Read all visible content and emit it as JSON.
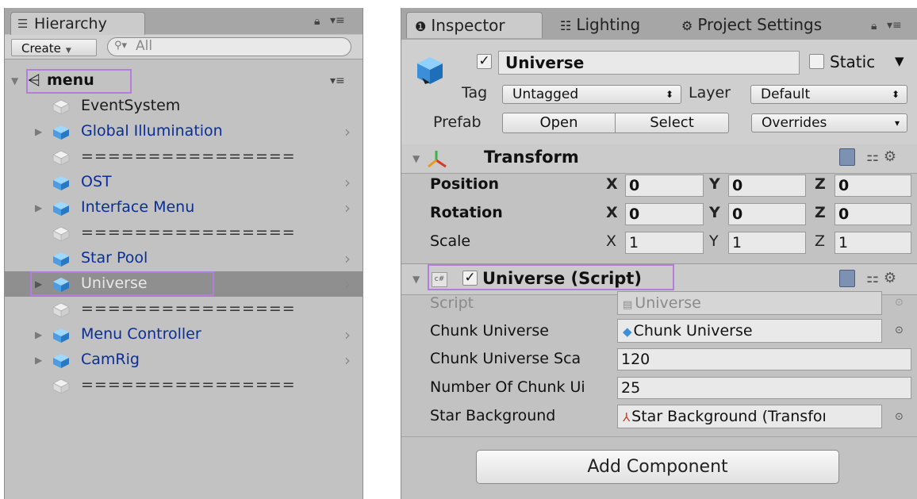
{
  "hierarchy": {
    "tab_label": "Hierarchy",
    "create_label": "Create",
    "search_placeholder": "All",
    "scene_name": "menu",
    "items": [
      {
        "label": "EventSystem",
        "style": "plain",
        "expandable": false,
        "arrow": false
      },
      {
        "label": "Global Illumination",
        "style": "prefab",
        "expandable": true,
        "arrow": true
      },
      {
        "label": "================",
        "style": "separator",
        "expandable": false,
        "arrow": false
      },
      {
        "label": "OST",
        "style": "prefab",
        "expandable": false,
        "arrow": true
      },
      {
        "label": "Interface Menu",
        "style": "prefab",
        "expandable": true,
        "arrow": true
      },
      {
        "label": "================",
        "style": "separator",
        "expandable": false,
        "arrow": false
      },
      {
        "label": "Star Pool",
        "style": "prefab",
        "expandable": false,
        "arrow": true
      },
      {
        "label": "Universe",
        "style": "prefab",
        "expandable": true,
        "arrow": true,
        "selected": true
      },
      {
        "label": "================",
        "style": "separator",
        "expandable": false,
        "arrow": false
      },
      {
        "label": "Menu Controller",
        "style": "prefab",
        "expandable": true,
        "arrow": true
      },
      {
        "label": "CamRig",
        "style": "prefab",
        "expandable": true,
        "arrow": true
      },
      {
        "label": "================",
        "style": "separator",
        "expandable": false,
        "arrow": false
      }
    ]
  },
  "inspector": {
    "tabs": [
      "Inspector",
      "Lighting",
      "Project Settings"
    ],
    "object_name": "Universe",
    "static_label": "Static",
    "tag_label": "Tag",
    "tag_value": "Untagged",
    "layer_label": "Layer",
    "layer_value": "Default",
    "prefab_label": "Prefab",
    "prefab_open": "Open",
    "prefab_select": "Select",
    "prefab_overrides": "Overrides",
    "transform": {
      "title": "Transform",
      "position_label": "Position",
      "rotation_label": "Rotation",
      "scale_label": "Scale",
      "axes": [
        "X",
        "Y",
        "Z"
      ],
      "position": [
        "0",
        "0",
        "0"
      ],
      "rotation": [
        "0",
        "0",
        "0"
      ],
      "scale": [
        "1",
        "1",
        "1"
      ]
    },
    "script_component": {
      "title": "Universe (Script)",
      "script_label": "Script",
      "script_value": "Universe",
      "chunk_universe_label": "Chunk Universe",
      "chunk_universe_value": "Chunk Universe",
      "chunk_scale_label": "Chunk Universe Sca",
      "chunk_scale_value": "120",
      "num_chunk_label": "Number Of Chunk Ui",
      "num_chunk_value": "25",
      "star_bg_label": "Star Background",
      "star_bg_value": "Star Background (Transfoı"
    },
    "add_component": "Add Component"
  },
  "colors": {
    "highlight_box": "#b37cde",
    "prefab_text": "#0b2e96",
    "panel_bg": "#c2c2c2",
    "selected_row": "#8f8f8f"
  }
}
